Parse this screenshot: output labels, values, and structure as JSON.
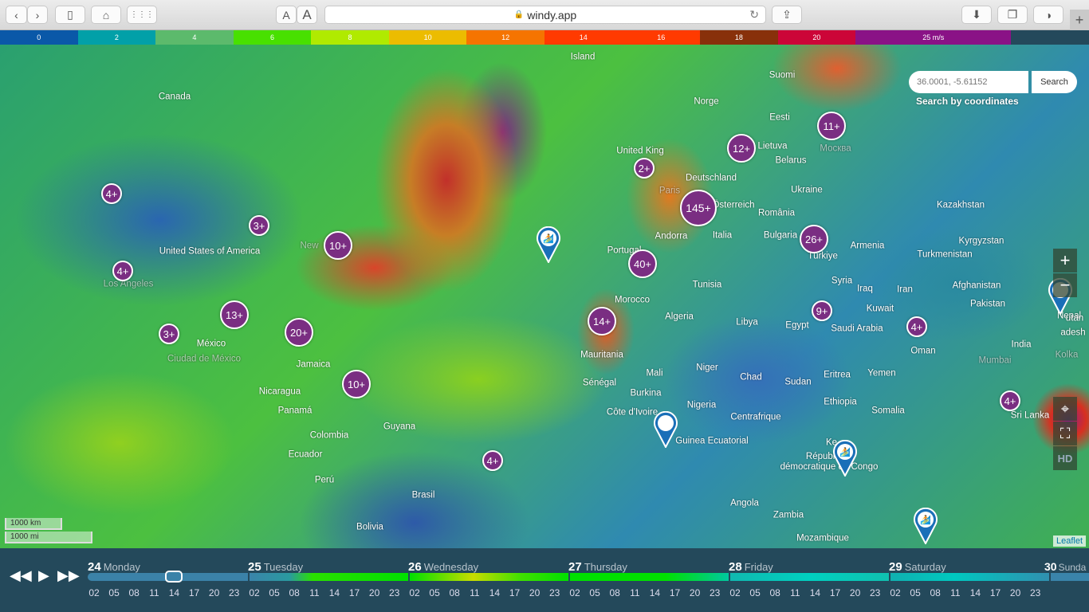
{
  "browser": {
    "url": "windy.app",
    "text_small": "A",
    "text_large": "A"
  },
  "legend": [
    {
      "label": "0",
      "color": "#0a58a8",
      "span": 1
    },
    {
      "label": "2",
      "color": "#02a0a8",
      "span": 1
    },
    {
      "label": "4",
      "color": "#5cba6c",
      "span": 1
    },
    {
      "label": "6",
      "color": "#48e000",
      "span": 1
    },
    {
      "label": "8",
      "color": "#b0ea00",
      "span": 1
    },
    {
      "label": "10",
      "color": "#ecbc00",
      "span": 1
    },
    {
      "label": "12",
      "color": "#f57400",
      "span": 1
    },
    {
      "label": "14",
      "color": "#ff3a00",
      "span": 1
    },
    {
      "label": "16",
      "color": "#ff3a00",
      "span": 1
    },
    {
      "label": "18",
      "color": "#88300a",
      "span": 1
    },
    {
      "label": "20",
      "color": "#cc0538",
      "span": 1
    },
    {
      "label": "25 m/s",
      "color": "#8a1286",
      "span": 2
    }
  ],
  "search": {
    "placeholder": "36.0001, -5.61152",
    "button": "Search",
    "caption": "Search by coordinates"
  },
  "map": {
    "labels": [
      "Island",
      "Suomi",
      "Canada",
      "Norge",
      "Eesti",
      "Lietuva",
      "Москва",
      "United King",
      "Belarus",
      "Deutschland",
      "Ukraine",
      "Kazakhstan",
      "România",
      "Bulgaria",
      "Türkiye",
      "Armenia",
      "Kyrgyzstan",
      "Turkmenistan",
      "United States of America",
      "New",
      "Los Angeles",
      "Portugal",
      "Italia",
      "Tunisia",
      "Syria",
      "Iraq",
      "Iran",
      "Afghanistan",
      "Pakistan",
      "Nepal",
      "Morocco",
      "Algeria",
      "Libya",
      "Egypt",
      "Kuwait",
      "Saudi Arabia",
      "Oman",
      "India",
      "Mumbai",
      "México",
      "Ciudad de México",
      "Jamaica",
      "Nicaragua",
      "Panamá",
      "Mauritania",
      "Mali",
      "Niger",
      "Chad",
      "Sudan",
      "Eritrea",
      "Yemen",
      "Sénégal",
      "Burkina",
      "Nigeria",
      "Côte d'Ivoire",
      "Ethiopia",
      "Somalia",
      "Centrafrique",
      "Guinea Ecuatorial",
      "République démocratique du Congo",
      "Ke",
      "Sri Lanka",
      "Colombia",
      "Guyana",
      "Ecuador",
      "Perú",
      "Brasil",
      "Bolivia",
      "Angola",
      "Zambia",
      "Mozambique",
      "Kolka",
      "adesh",
      "utan",
      "Paris",
      "Andorra",
      "Österreich"
    ],
    "clusters": [
      "4+",
      "3+",
      "10+",
      "4+",
      "13+",
      "3+",
      "20+",
      "10+",
      "4+",
      "2+",
      "145+",
      "12+",
      "11+",
      "26+",
      "40+",
      "14+",
      "9+",
      "4+",
      "4+"
    ],
    "pins": [
      "surf-spot",
      "location",
      "surf-spot",
      "surf-spot",
      "location"
    ],
    "scale_km": "1000 km",
    "scale_mi": "1000 mi",
    "attribution": "Leaflet",
    "controls": {
      "zoom_in": "+",
      "zoom_out": "−",
      "hd": "HD"
    }
  },
  "timeline": {
    "days": [
      {
        "num": "24",
        "name": "Monday"
      },
      {
        "num": "25",
        "name": "Tuesday"
      },
      {
        "num": "26",
        "name": "Wednesday"
      },
      {
        "num": "27",
        "name": "Thursday"
      },
      {
        "num": "28",
        "name": "Friday"
      },
      {
        "num": "29",
        "name": "Saturday"
      },
      {
        "num": "30",
        "name": "Sunda"
      }
    ],
    "hours": [
      "02",
      "05",
      "08",
      "11",
      "14",
      "17",
      "20",
      "23"
    ],
    "selected": "Monday 14:00"
  }
}
